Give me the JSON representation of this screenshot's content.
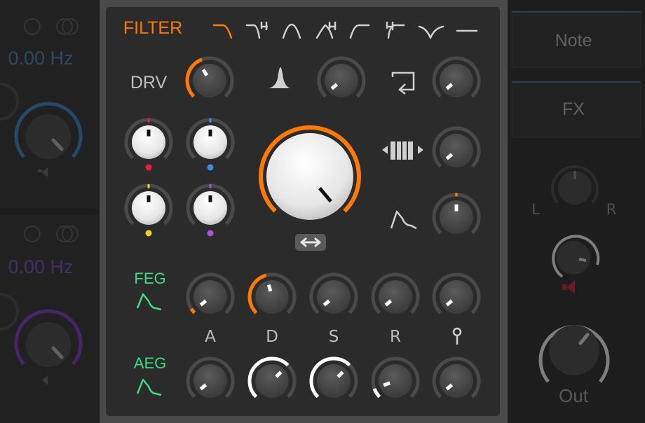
{
  "left_panel": {
    "osc1_freq": "0.00 Hz",
    "osc2_freq": "0.00 Hz"
  },
  "filter": {
    "title": "FILTER",
    "filter_types": [
      "lowpass-icon",
      "lowpass-steep-icon",
      "bandpass-icon",
      "bandpass-steep-icon",
      "highpass-icon",
      "highpass-steep-icon",
      "notch-icon",
      "flat-icon"
    ],
    "drive_label": "DRV",
    "feg_label": "FEG",
    "aeg_label": "AEG",
    "adsr_labels": [
      "A",
      "D",
      "S",
      "R"
    ],
    "accent_color": "#ff7a00",
    "env_color": "#3ddc84"
  },
  "right_panel": {
    "note_label": "Note",
    "fx_label": "FX",
    "pan_left": "L",
    "pan_right": "R",
    "out_label": "Out"
  }
}
